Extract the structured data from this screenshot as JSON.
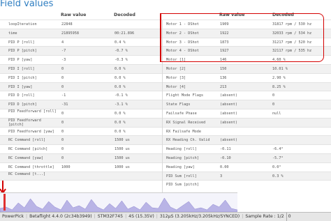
{
  "title": "Field values",
  "headers": {
    "raw": "Raw value",
    "decoded": "Decoded"
  },
  "left_rows": [
    {
      "name": "loopIteration",
      "raw": "22848",
      "decoded": ""
    },
    {
      "name": "time",
      "raw": "21895958",
      "decoded": "00:21.896"
    },
    {
      "name": "PID P [roll]",
      "raw": "4",
      "decoded": "0.4 %"
    },
    {
      "name": "PID P [pitch]",
      "raw": "-7",
      "decoded": "-0.7 %"
    },
    {
      "name": "PID P [yaw]",
      "raw": "-3",
      "decoded": "-0.3 %"
    },
    {
      "name": "PID I [roll]",
      "raw": "0",
      "decoded": "0.0 %"
    },
    {
      "name": "PID I [pitch]",
      "raw": "0",
      "decoded": "0.0 %"
    },
    {
      "name": "PID I [yaw]",
      "raw": "0",
      "decoded": "0.0 %"
    },
    {
      "name": "PID D [roll]",
      "raw": "-1",
      "decoded": "-0.1 %"
    },
    {
      "name": "PID D [pitch]",
      "raw": "-31",
      "decoded": "-3.1 %"
    },
    {
      "name": "PID Feedforward [roll]",
      "raw": "0",
      "decoded": "0.0 %"
    },
    {
      "name": "PID Feedforward [pitch]",
      "raw": "0",
      "decoded": "0.0 %"
    },
    {
      "name": "PID Feedforward [yaw]",
      "raw": "0",
      "decoded": "0.0 %"
    },
    {
      "name": "RC Command [roll]",
      "raw": "0",
      "decoded": "1500 us"
    },
    {
      "name": "RC Command [pitch]",
      "raw": "0",
      "decoded": "1500 us"
    },
    {
      "name": "RC Command [yaw]",
      "raw": "0",
      "decoded": "1500 us"
    },
    {
      "name": "RC Command [throttle]",
      "raw": "1000",
      "decoded": "1000 us"
    },
    {
      "name": "RC Command [t...]",
      "raw": "",
      "decoded": ""
    }
  ],
  "right_rows": [
    {
      "name": "Motor 1 - DShot",
      "raw": "1909",
      "decoded": "31817 rpm / 530 hz"
    },
    {
      "name": "Motor 2 - DShot",
      "raw": "1922",
      "decoded": "32033 rpm / 534 hz"
    },
    {
      "name": "Motor 3 - DShot",
      "raw": "1873",
      "decoded": "31217 rpm / 520 hz"
    },
    {
      "name": "Motor 4 - DShot",
      "raw": "1927",
      "decoded": "32117 rpm / 535 hz"
    },
    {
      "name": "Motor [1]",
      "raw": "146",
      "decoded": "4.60 %"
    },
    {
      "name": "Motor [2]",
      "raw": "150",
      "decoded": "10.01 %"
    },
    {
      "name": "Motor [3]",
      "raw": "136",
      "decoded": "2.90 %"
    },
    {
      "name": "Motor [4]",
      "raw": "213",
      "decoded": "8.25 %"
    },
    {
      "name": "Flight Mode Flags",
      "raw": "(absent)",
      "decoded": "0"
    },
    {
      "name": "State Flags",
      "raw": "(absent)",
      "decoded": "0"
    },
    {
      "name": "Failsafe Phase",
      "raw": "(absent)",
      "decoded": "null"
    },
    {
      "name": "RX Signal Received",
      "raw": "(absent)",
      "decoded": ""
    },
    {
      "name": "RX Failsafe Mode",
      "raw": "",
      "decoded": ""
    },
    {
      "name": "RX Heading Ch. Valid",
      "raw": "(absent)",
      "decoded": ""
    },
    {
      "name": "Heading [roll]",
      "raw": "-0.11",
      "decoded": "-6.4°"
    },
    {
      "name": "Heading [pitch]",
      "raw": "-0.10",
      "decoded": "-5.7°"
    },
    {
      "name": "Heading [yaw]",
      "raw": "0.00",
      "decoded": "0.0°"
    },
    {
      "name": "PID Sum [roll]",
      "raw": "3",
      "decoded": "0.3 %"
    },
    {
      "name": "PID Sum [pitch]",
      "raw": "",
      "decoded": ""
    }
  ],
  "status_bar": {
    "app": "PowerPick",
    "firmware": "Betaflight 4.4.0 (2c34b3949)",
    "board": "STM32F745",
    "cells": "4S (15.35V)",
    "loop": "312µS (3.205kHz/3.205kHz/SYNCED)",
    "sample_rate": "Sample Rate : 1/2",
    "zero": "0"
  },
  "colors": {
    "accent": "#2f7ec1",
    "highlight": "#d40000",
    "graph_fill": "#b9b4e6"
  }
}
